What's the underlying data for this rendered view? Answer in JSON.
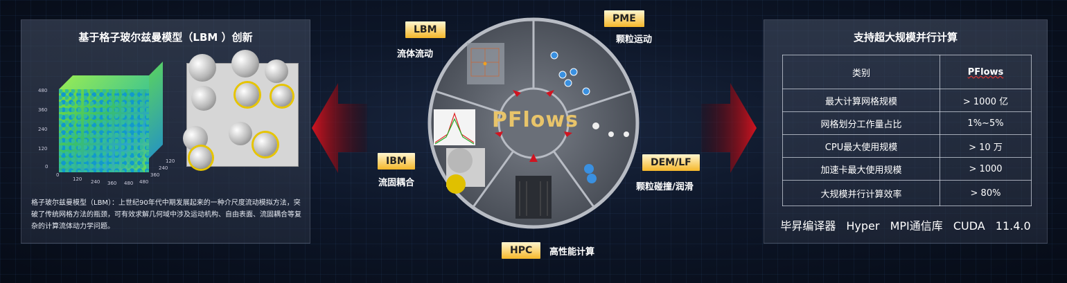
{
  "left": {
    "title": "基于格子玻尔兹曼模型（LBM ）创新",
    "description": "格子玻尔兹曼模型（LBM）：上世纪90年代中期发展起来的一种介尺度流动模拟方法，突破了传统网格方法的瓶颈，可有效求解几何域中涉及运动机构、自由表面、流固耦合等复杂的计算流体动力学问题。",
    "cube_ticks": [
      "480",
      "360",
      "240",
      "120",
      "0",
      "0",
      "120",
      "240",
      "360",
      "480",
      "480",
      "360",
      "240",
      "120"
    ]
  },
  "wheel": {
    "center_label": "PFlows",
    "sections": [
      {
        "tag": "LBM",
        "caption": "流体流动"
      },
      {
        "tag": "PME",
        "caption": "颗粒运动"
      },
      {
        "tag": "DEM/LF",
        "caption": "颗粒碰撞/润滑"
      },
      {
        "tag": "HPC",
        "caption": "高性能计算"
      },
      {
        "tag": "IBM",
        "caption": "流固耦合"
      }
    ]
  },
  "right": {
    "title": "支持超大规模并行计算",
    "table": {
      "headers": [
        "类别",
        "PFlows"
      ],
      "rows": [
        [
          "最大计算网格规模",
          "> 1000 亿"
        ],
        [
          "网格划分工作量占比",
          "1%~5%"
        ],
        [
          "CPU最大使用规模",
          "> 10 万"
        ],
        [
          "加速卡最大使用规模",
          "> 1000"
        ],
        [
          "大规模并行计算效率",
          "> 80%"
        ]
      ]
    },
    "footer": "毕昇编译器   Hyper MPI通信库   CUDA 11.4.0"
  },
  "colors": {
    "accent_red": "#c0101a",
    "tag_gold": "#f5b72a",
    "brand_text": "#e8c46a"
  }
}
